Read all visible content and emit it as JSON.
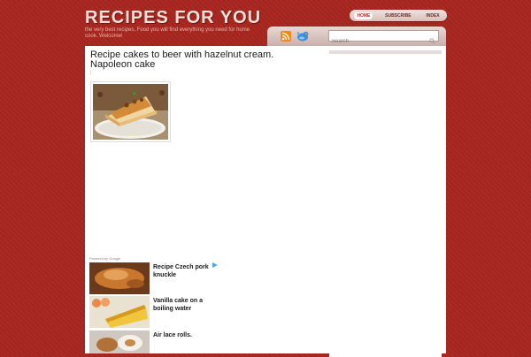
{
  "site": {
    "title": "RECIPES FOR YOU",
    "tagline": "the very best recipes, Food you will find everything you need for home cook. Welcome!"
  },
  "nav": {
    "items": [
      {
        "label": "HOME",
        "active": true
      },
      {
        "label": "SUBSCRIBE",
        "active": false
      },
      {
        "label": "INDEX",
        "active": false
      }
    ]
  },
  "icons": {
    "rss": "rss-icon",
    "twitter": "twitter-bird-icon",
    "search": "magnifier-icon"
  },
  "search": {
    "placeholder": "Search",
    "value": ""
  },
  "post": {
    "title": "Recipe cakes to beer with hazelnut cream. Napoleon cake",
    "meta": "|",
    "image_alt": "Napoleon cake slice on a lace doily"
  },
  "related": {
    "powered_by": "Powered by Google",
    "items": [
      {
        "title": "Recipe Czech pork knuckle"
      },
      {
        "title": "Vanilla cake on a boiling water"
      },
      {
        "title": "Air lace rolls."
      }
    ]
  },
  "colors": {
    "background": "#a8271f",
    "title_text": "#f3e2dc",
    "nav_active": "#c0241a"
  }
}
